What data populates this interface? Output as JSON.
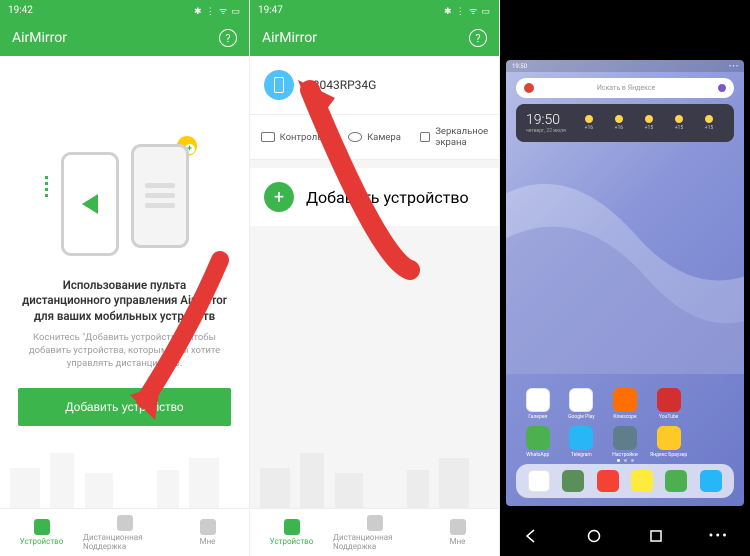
{
  "panel1": {
    "status_time": "19:42",
    "status_icons": "✱ ⋮ ᯤ ▭",
    "app_title": "AirMirror",
    "heading": "Использование пульта дистанционного управления AirMirror для ваших мобильных устройств",
    "subtext": "Коснитесь \"Добавить устройство\", чтобы добавить устройства, которыми вы хотите управлять дистанционно.",
    "add_button": "Добавить устройство",
    "tabs": [
      {
        "label": "Устройство",
        "active": true
      },
      {
        "label": "Дистанционная Nоддержка",
        "active": false
      },
      {
        "label": "Мне",
        "active": false
      }
    ]
  },
  "panel2": {
    "status_time": "19:47",
    "status_icons": "✱ ⋮ ᯤ ▭",
    "app_title": "AirMirror",
    "device_name": "23043RP34G",
    "actions": [
      {
        "label": "Контроль"
      },
      {
        "label": "Камера"
      },
      {
        "label": "Зеркальное экрана"
      }
    ],
    "add_device_label": "Добавить устройство",
    "tabs": [
      {
        "label": "Устройство",
        "active": true
      },
      {
        "label": "Дистанционная Nоддержка",
        "active": false
      },
      {
        "label": "Мне",
        "active": false
      }
    ]
  },
  "panel3": {
    "status_time": "19:50",
    "status_right": "• • •",
    "search_placeholder": "Искать в Яндексе",
    "widget_time": "19:50",
    "widget_date": "четверг, 22 июля",
    "forecast": [
      "+16",
      "+16",
      "+15",
      "+15",
      "+15"
    ],
    "apps_row1": [
      {
        "label": "Галерея",
        "color": "#ffffff"
      },
      {
        "label": "Google Play",
        "color": "#ffffff"
      },
      {
        "label": "Kinescope",
        "color": "#ff6f00"
      },
      {
        "label": "YouTube",
        "color": "#d32f2f"
      },
      {
        "label": "",
        "color": "transparent"
      }
    ],
    "apps_row2": [
      {
        "label": "WhatsApp",
        "color": "#4caf50"
      },
      {
        "label": "Telegram",
        "color": "#29b6f6"
      },
      {
        "label": "Настройки",
        "color": "#607d8b"
      },
      {
        "label": "Яндекс Браузер",
        "color": "#ffca28"
      },
      {
        "label": "",
        "color": "transparent"
      }
    ],
    "dock": [
      {
        "color": "#ffffff"
      },
      {
        "color": "#5a8f5a"
      },
      {
        "color": "#f44336"
      },
      {
        "color": "#ffeb3b"
      },
      {
        "color": "#4caf50"
      },
      {
        "color": "#29b6f6"
      }
    ]
  },
  "colors": {
    "primary": "#3cb54c",
    "arrow": "#e53935"
  }
}
